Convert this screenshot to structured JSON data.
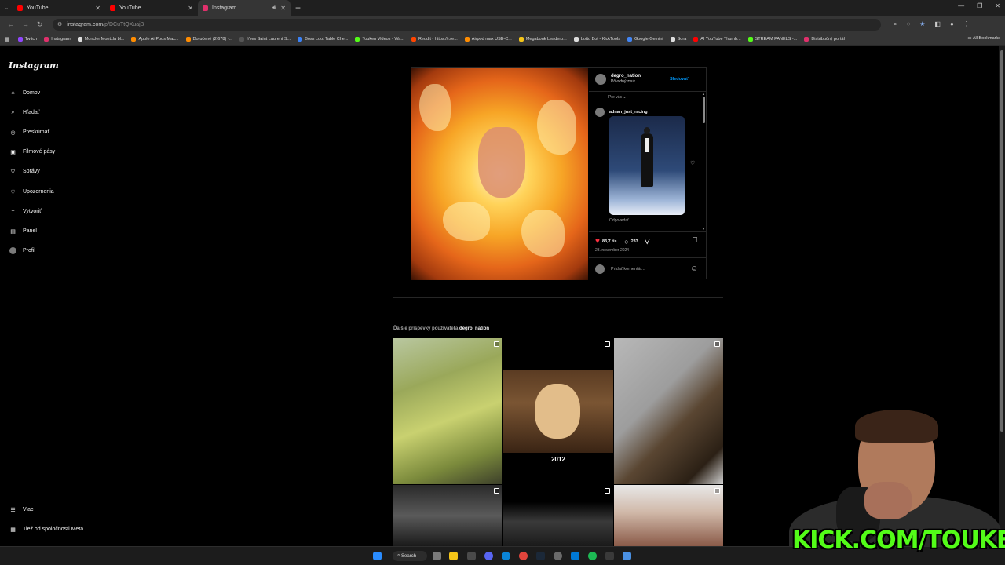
{
  "browser": {
    "tabs": [
      {
        "title": "YouTube",
        "color": "#ff0000"
      },
      {
        "title": "YouTube",
        "color": "#ff0000"
      },
      {
        "title": "Instagram",
        "color": "#e1306c"
      }
    ],
    "url_host": "instagram.com",
    "url_path": "/p/DCuTtQXuajB",
    "bookmarks": [
      {
        "label": "Twitch",
        "color": "#9146ff"
      },
      {
        "label": "Instagram",
        "color": "#e1306c"
      },
      {
        "label": "Moncler Montcla bl...",
        "color": "#dddddd"
      },
      {
        "label": "Apple AirPods Max...",
        "color": "#ff8c00"
      },
      {
        "label": "Doručené (2 678) -...",
        "color": "#ff8c00"
      },
      {
        "label": "Yves Saint Laurent S...",
        "color": "#555555"
      },
      {
        "label": "Boss Loot Table Che...",
        "color": "#3b82f6"
      },
      {
        "label": "Touken Videos - Wa...",
        "color": "#53fc18"
      },
      {
        "label": "Reddit - https://r.re...",
        "color": "#ff4500"
      },
      {
        "label": "Airpod max USB-C...",
        "color": "#ff8c00"
      },
      {
        "label": "Megabonk Leaderb...",
        "color": "#f5c518"
      },
      {
        "label": "Lotto Bot - KickTools",
        "color": "#dddddd"
      },
      {
        "label": "Google Gemini",
        "color": "#4285f4"
      },
      {
        "label": "Sora",
        "color": "#dddddd"
      },
      {
        "label": "AI YouTube Thumb...",
        "color": "#ff0000"
      },
      {
        "label": "STREAM PANELS -...",
        "color": "#53fc18"
      },
      {
        "label": "Distribučný portál",
        "color": "#e1306c"
      }
    ],
    "all_bookmarks": "All Bookmarks"
  },
  "sidebar": {
    "logo": "Instagram",
    "items": [
      {
        "label": "Domov",
        "icon": "home-icon"
      },
      {
        "label": "Hľadať",
        "icon": "search-icon"
      },
      {
        "label": "Preskúmať",
        "icon": "compass-icon"
      },
      {
        "label": "Filmové pásy",
        "icon": "reels-icon"
      },
      {
        "label": "Správy",
        "icon": "send-icon"
      },
      {
        "label": "Upozornenia",
        "icon": "heart-icon"
      },
      {
        "label": "Vytvoriť",
        "icon": "plus-icon"
      },
      {
        "label": "Panel",
        "icon": "dashboard-icon"
      },
      {
        "label": "Profil",
        "icon": "avatar-icon"
      }
    ],
    "bottom": [
      {
        "label": "Viac",
        "icon": "menu-icon"
      },
      {
        "label": "Tiež od spoločnosti Meta",
        "icon": "meta-icon"
      }
    ]
  },
  "post": {
    "owner": "degro_nation",
    "audio": "Pôvodný zvuk",
    "follow": "Sledovať",
    "for_you": "Pre vás",
    "commenter": "adnan_just_racing",
    "reply": "Odpovedať",
    "likes": "83,7 tis.",
    "comments": "233",
    "date": "23. november 2024",
    "add_comment": "Pridať komentár..."
  },
  "more_posts": {
    "prefix": "Ďalšie príspevky používateľa",
    "user": "degro_nation",
    "tile_caption": "2012"
  },
  "taskbar": {
    "search": "Search"
  },
  "overlay": {
    "kick": "KICK.COM/TOUKEN"
  }
}
